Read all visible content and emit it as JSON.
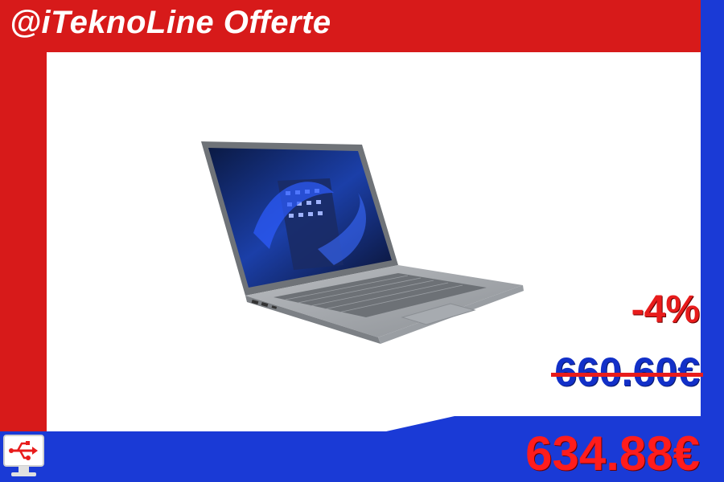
{
  "header": {
    "title": "@iTeknoLine Offerte"
  },
  "product": {
    "image": "laptop-photo",
    "discount": "-4%",
    "old_price": "660.60€",
    "new_price": "634.88€"
  },
  "brand": {
    "icon": "usb-monitor-logo-icon"
  },
  "colors": {
    "red": "#d71a1a",
    "blue": "#1a3ad6",
    "price_red": "#ff1c1c",
    "old_price_blue": "#1230c8"
  }
}
